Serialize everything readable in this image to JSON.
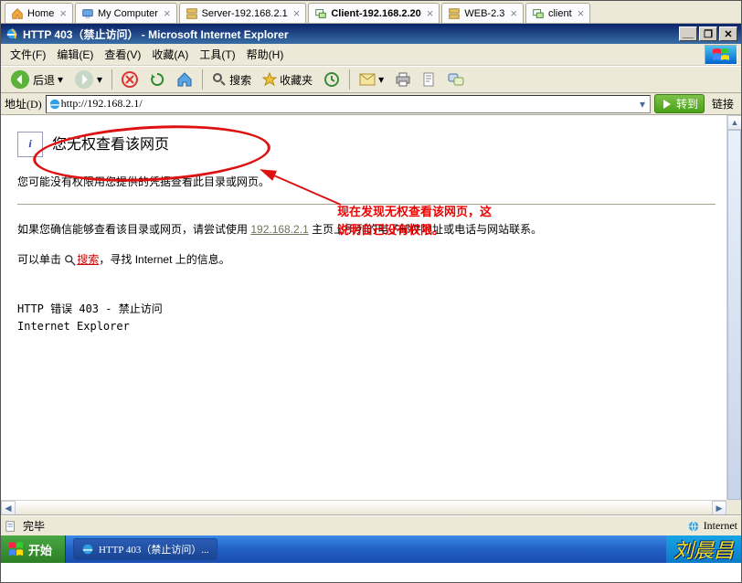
{
  "vm_tabs": {
    "t0": "Home",
    "t1": "My Computer",
    "t2": "Server-192.168.2.1",
    "t3": "Client-192.168.2.20",
    "t4": "WEB-2.3",
    "t5": "client"
  },
  "ie": {
    "title": "HTTP 403（禁止访问） - Microsoft Internet Explorer",
    "menu": {
      "file": "文件(F)",
      "edit": "编辑(E)",
      "view": "查看(V)",
      "favorites": "收藏(A)",
      "tools": "工具(T)",
      "help": "帮助(H)"
    },
    "toolbar": {
      "back": "后退",
      "search": "搜索",
      "favorites": "收藏夹"
    },
    "addr": {
      "label": "地址(D)",
      "url": "http://192.168.2.1/",
      "go": "转到",
      "links": "链接"
    },
    "status": {
      "done": "完毕",
      "zone": "Internet"
    }
  },
  "page": {
    "headline": "您无权查看该网页",
    "line1": "您可能没有权限用您提供的凭据查看此目录或网页。",
    "line2a": "如果您确信能够查看该目录或网页，请尝试使用 ",
    "link_host": "192.168.2.1",
    "line2b": " 主页上所列的电子邮件地址或电话与网站联系。",
    "line3a": "可以单击",
    "search_link": "搜索",
    "line3b": "，寻找 Internet 上的信息。",
    "error_code": "HTTP 错误 403 - 禁止访问",
    "browser": "Internet Explorer"
  },
  "annotation": {
    "line1": "现在发现无权查看该网页，这",
    "line2": "说明自己没有权限。"
  },
  "taskbar": {
    "start": "开始",
    "task_ie": "HTTP 403（禁止访问）...",
    "signature": "刘晨昌"
  }
}
